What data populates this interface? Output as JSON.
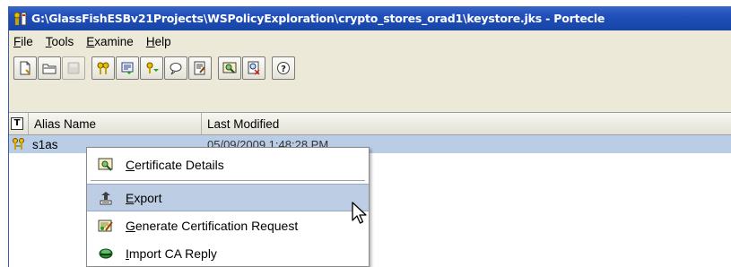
{
  "window": {
    "title": "G:\\GlassFishESBv21Projects\\WSPolicyExploration\\crypto_stores_orad1\\keystore.jks - Portecle"
  },
  "menubar": {
    "items": [
      {
        "label_first": "F",
        "label_rest": "ile"
      },
      {
        "label_first": "T",
        "label_rest": "ools"
      },
      {
        "label_first": "E",
        "label_rest": "xamine"
      },
      {
        "label_first": "H",
        "label_rest": "elp"
      }
    ]
  },
  "toolbar": {
    "buttons": [
      "new-keystore-icon",
      "open-keystore-icon",
      "save-keystore-icon",
      "generate-keypair-icon",
      "import-trusted-cert-icon",
      "import-keypair-icon",
      "set-password-icon",
      "keystore-report-icon",
      "examine-certificate-icon",
      "examine-crl-icon",
      "help-icon"
    ]
  },
  "table": {
    "columns": {
      "type": "T",
      "alias": "Alias Name",
      "last_modified": "Last Modified"
    },
    "rows": [
      {
        "alias": "s1as",
        "last_modified": "05/09/2009 1:48:28 PM"
      }
    ]
  },
  "context_menu": {
    "items": [
      {
        "first": "C",
        "rest": "ertificate Details",
        "icon": "certificate-details-icon"
      },
      {
        "first": "E",
        "rest": "xport",
        "icon": "export-icon"
      },
      {
        "first": "G",
        "rest": "enerate Certification Request",
        "icon": "generate-csr-icon"
      },
      {
        "first": "I",
        "rest": "mport CA Reply",
        "icon": "import-ca-reply-icon"
      }
    ]
  },
  "colors": {
    "titlebar": "#1f4fb8",
    "selection": "#b9cde6",
    "menu_hover": "#bccde4"
  }
}
